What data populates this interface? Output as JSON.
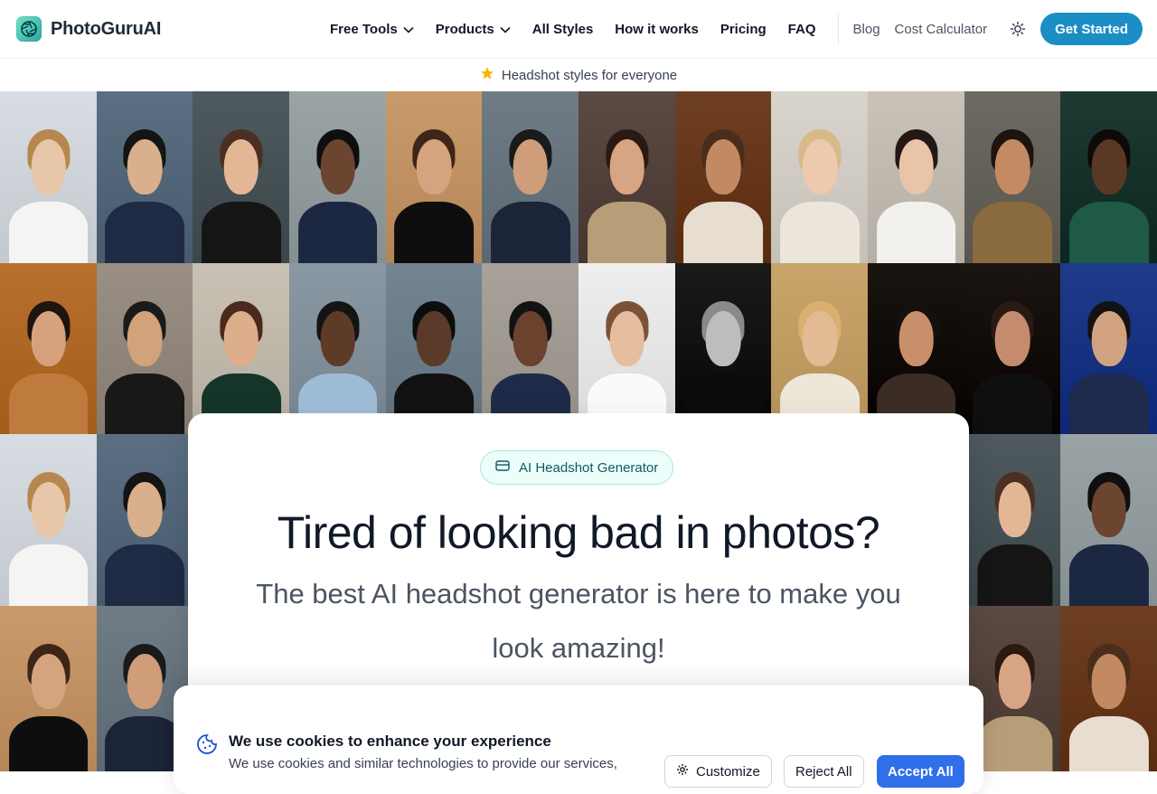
{
  "brand": {
    "name": "PhotoGuruAI",
    "logo_icon": "aperture-icon",
    "accent": "#1a8ec5"
  },
  "nav": {
    "items": [
      {
        "label": "Free Tools",
        "dropdown": true
      },
      {
        "label": "Products",
        "dropdown": true
      },
      {
        "label": "All Styles",
        "dropdown": false
      },
      {
        "label": "How it works",
        "dropdown": false
      },
      {
        "label": "Pricing",
        "dropdown": false
      },
      {
        "label": "FAQ",
        "dropdown": false
      }
    ],
    "secondary": [
      {
        "label": "Blog"
      },
      {
        "label": "Cost Calculator"
      }
    ],
    "theme_icon": "sun-icon",
    "cta_label": "Get Started"
  },
  "announcement": {
    "icon": "star-icon",
    "text": "Headshot styles for everyone"
  },
  "hero": {
    "badge_icon": "card-icon",
    "badge_label": "AI Headshot Generator",
    "title": "Tired of looking bad in photos?",
    "subtitle": "The best AI headshot generator is here to make you look amazing!"
  },
  "cookie": {
    "icon": "cookie-icon",
    "title": "We use cookies to enhance your experience",
    "text": "We use cookies and similar technologies to provide our services,",
    "customize_label": "Customize",
    "reject_label": "Reject All",
    "accept_label": "Accept All",
    "accept_color": "#2f6fe8"
  },
  "gallery": {
    "photo_palettes": [
      [
        "#d7dde2",
        "#e8c6a8",
        "#f4f4f2",
        "#b8874f"
      ],
      [
        "#5c6f82",
        "#d9b08c",
        "#1f2a44",
        "#141414"
      ],
      [
        "#4e5a5e",
        "#e3b796",
        "#151515",
        "#4b2f22"
      ],
      [
        "#9aa3a6",
        "#6b4530",
        "#1c2741",
        "#0f0f0f"
      ],
      [
        "#c99a6b",
        "#d6a37f",
        "#0e0e0e",
        "#3e2518"
      ],
      [
        "#6f7c86",
        "#cf9d7a",
        "#1b2438",
        "#1a1a1a"
      ],
      [
        "#5b4a44",
        "#d8a584",
        "#b79e78",
        "#2a1a12"
      ],
      [
        "#6e3f22",
        "#c28a63",
        "#e7ddd0",
        "#4a2e1c"
      ],
      [
        "#d9d4cc",
        "#edc9ae",
        "#ece6dc",
        "#d7b98a"
      ],
      [
        "#c9c2b8",
        "#e8c4a9",
        "#f3f1ee",
        "#241814"
      ],
      [
        "#6d6a62",
        "#c48a62",
        "#8a6a3f",
        "#1d140f"
      ],
      [
        "#1f3a33",
        "#5a3826",
        "#1f5a44",
        "#0e0a08"
      ],
      [
        "#b8702e",
        "#d6a27e",
        "#bf7a3d",
        "#1e1410"
      ],
      [
        "#9a8f84",
        "#d2a27a",
        "#181818",
        "#1a1a1a"
      ],
      [
        "#c8c1b4",
        "#dcae8c",
        "#15352a",
        "#4a2a1c"
      ],
      [
        "#8a98a4",
        "#5e3b27",
        "#9fbcd6",
        "#141414"
      ],
      [
        "#748592",
        "#5a3a29",
        "#121212",
        "#0d0d0d"
      ],
      [
        "#a8a29a",
        "#6a422d",
        "#1e2b48",
        "#121212"
      ],
      [
        "#eeeeee",
        "#e6bd9e",
        "#fafafa",
        "#7c5236"
      ],
      [
        "#1a1a1a",
        "#bdbdbd",
        "#0c0c0c",
        "#8a8a8a"
      ],
      [
        "#c9a56c",
        "#e2bb95",
        "#efe6da",
        "#d9b070"
      ],
      [
        "#1a1410",
        "#c98f6a",
        "#3b2c26",
        "#15100d"
      ],
      [
        "#1b1512",
        "#c58b6e",
        "#0f0f0f",
        "#2a1a14"
      ],
      [
        "#1f3b8a",
        "#d1a27f",
        "#1e2a4e",
        "#121212"
      ]
    ]
  }
}
